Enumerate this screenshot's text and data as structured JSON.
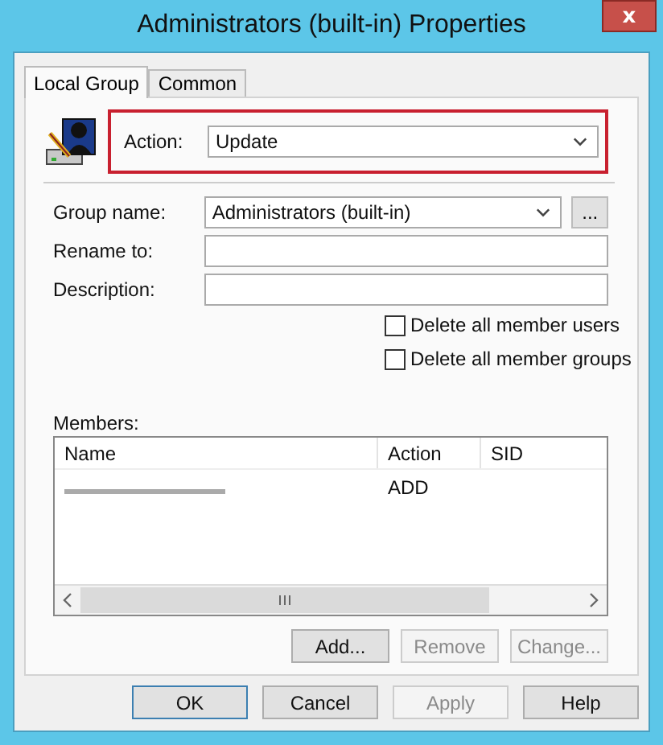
{
  "window": {
    "title": "Administrators (built-in) Properties",
    "close": "x"
  },
  "tabs": [
    {
      "label": "Local Group",
      "selected": true
    },
    {
      "label": "Common",
      "selected": false
    }
  ],
  "action": {
    "label": "Action:",
    "value": "Update",
    "highlighted": true
  },
  "fields": [
    {
      "kind": "combo",
      "label": "Group name:",
      "value": "Administrators (built-in)",
      "browse": "..."
    },
    {
      "kind": "text",
      "label": "Rename to:"
    },
    {
      "kind": "text",
      "label": "Description:"
    }
  ],
  "options": [
    {
      "label": "Delete all member users",
      "checked": false
    },
    {
      "label": "Delete all member groups",
      "checked": false
    }
  ],
  "members": {
    "label": "Members:",
    "columns": [
      "Name",
      "Action",
      "SID"
    ],
    "rows": [
      {
        "name_redacted": true,
        "action": "ADD"
      }
    ]
  },
  "member_buttons": [
    {
      "label": "Add...",
      "disabled": false
    },
    {
      "label": "Remove",
      "disabled": true
    },
    {
      "label": "Change...",
      "disabled": true
    }
  ],
  "buttons": [
    {
      "label": "OK",
      "disabled": false,
      "default": true
    },
    {
      "label": "Cancel",
      "disabled": false,
      "default": false
    },
    {
      "label": "Apply",
      "disabled": true,
      "default": false
    },
    {
      "label": "Help",
      "disabled": false,
      "default": false
    }
  ]
}
